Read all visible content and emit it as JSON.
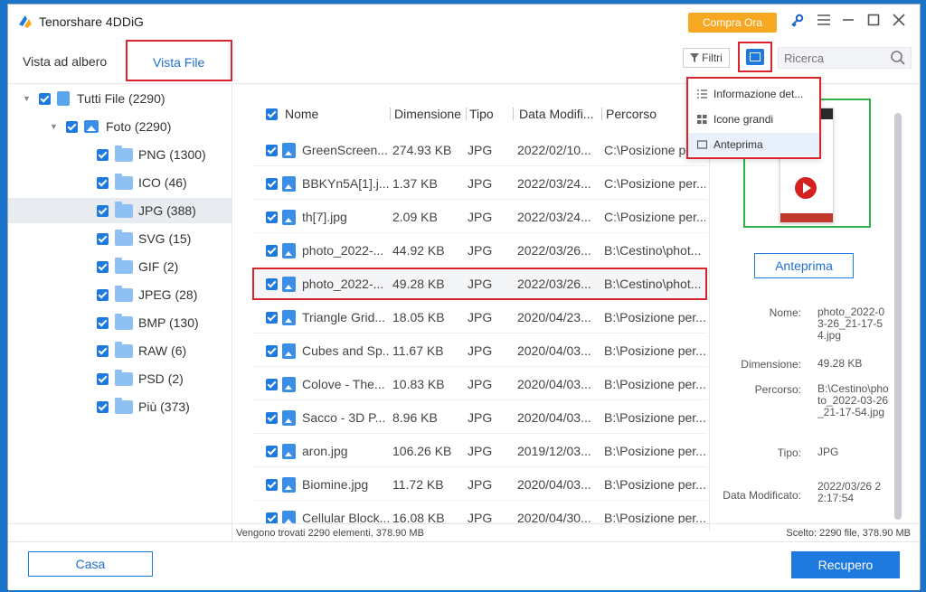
{
  "app": {
    "title": "Tenorshare 4DDiG",
    "buy_label": "Compra Ora"
  },
  "tabs": {
    "tree": "Vista ad albero",
    "file": "Vista File"
  },
  "toolbar": {
    "filter_label": "Filtri",
    "search_placeholder": "Ricerca"
  },
  "dropdown": {
    "items": [
      "Informazione det...",
      "Icone grandi",
      "Anteprima"
    ]
  },
  "tree": {
    "root": "Tutti File (2290)",
    "photos": "Foto (2290)",
    "items": [
      "PNG (1300)",
      "ICO (46)",
      "JPG (388)",
      "SVG (15)",
      "GIF (2)",
      "JPEG (28)",
      "BMP (130)",
      "RAW (6)",
      "PSD (2)",
      "Più (373)"
    ]
  },
  "table": {
    "headers": [
      "Nome",
      "Dimensione",
      "Tipo",
      "Data Modifi...",
      "Percorso"
    ],
    "rows": [
      [
        "GreenScreen...",
        "274.93 KB",
        "JPG",
        "2022/02/10...",
        "C:\\Posizione pe..."
      ],
      [
        "BBKYn5A[1].j...",
        "1.37 KB",
        "JPG",
        "2022/03/24...",
        "C:\\Posizione per..."
      ],
      [
        "th[7].jpg",
        "2.09 KB",
        "JPG",
        "2022/03/24...",
        "C:\\Posizione per..."
      ],
      [
        "photo_2022-...",
        "44.92 KB",
        "JPG",
        "2022/03/26...",
        "B:\\Cestino\\phot..."
      ],
      [
        "photo_2022-...",
        "49.28 KB",
        "JPG",
        "2022/03/26...",
        "B:\\Cestino\\phot..."
      ],
      [
        "Triangle Grid...",
        "18.05 KB",
        "JPG",
        "2020/04/23...",
        "B:\\Posizione per..."
      ],
      [
        "Cubes and Sp...",
        "11.67 KB",
        "JPG",
        "2020/04/03...",
        "B:\\Posizione per..."
      ],
      [
        "Colove - The...",
        "10.83 KB",
        "JPG",
        "2020/04/03...",
        "B:\\Posizione per..."
      ],
      [
        "Sacco - 3D P...",
        "8.96 KB",
        "JPG",
        "2020/04/03...",
        "B:\\Posizione per..."
      ],
      [
        "aron.jpg",
        "106.26 KB",
        "JPG",
        "2019/12/03...",
        "B:\\Posizione per..."
      ],
      [
        "Biomine.jpg",
        "11.72 KB",
        "JPG",
        "2020/04/03...",
        "B:\\Posizione per..."
      ],
      [
        "Cellular Block...",
        "16.08 KB",
        "JPG",
        "2020/04/30...",
        "B:\\Posizione per..."
      ]
    ]
  },
  "preview": {
    "button": "Anteprima",
    "name_label": "Nome:",
    "name_value": "photo_2022-03-26_21-17-54.jpg",
    "size_label": "Dimensione:",
    "size_value": "49.28 KB",
    "path_label": "Percorso:",
    "path_value": "B:\\Cestino\\photo_2022-03-26_21-17-54.jpg",
    "type_label": "Tipo:",
    "type_value": "JPG",
    "date_label": "Data Modificato:",
    "date_value": "2022/03/26 22:17:54"
  },
  "status": {
    "left": "Vengono trovati 2290 elementi, 378.90 MB",
    "right": "Scelto: 2290 file, 378.90 MB"
  },
  "footer": {
    "home": "Casa",
    "recover": "Recupero"
  }
}
